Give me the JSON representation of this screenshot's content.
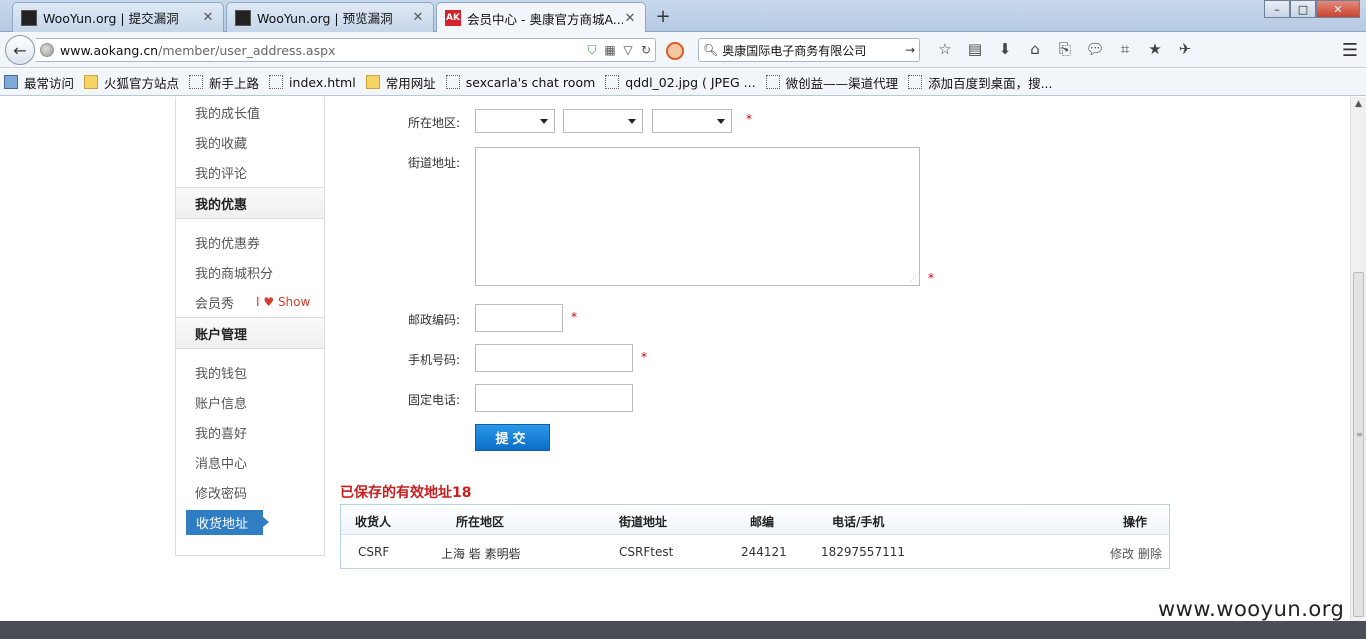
{
  "browser": {
    "tabs": [
      {
        "title": "WooYun.org | 提交漏洞",
        "icon": "wooyun-favicon",
        "active": false
      },
      {
        "title": "WooYun.org | 预览漏洞",
        "icon": "wooyun-favicon",
        "active": false
      },
      {
        "title": "会员中心 - 奥康官方商城A...",
        "icon": "aokang-favicon",
        "active": true
      }
    ],
    "ak_favicon_text": "AK",
    "new_tab": "+",
    "url_host": "www.aokang.cn",
    "url_path": "/member/user_address.aspx",
    "search_text": "奥康国际电子商务有限公司",
    "bookmarks": [
      {
        "label": "最常访问",
        "kind": "first"
      },
      {
        "label": "火狐官方站点",
        "kind": "folder"
      },
      {
        "label": "新手上路",
        "kind": "page"
      },
      {
        "label": "index.html",
        "kind": "page"
      },
      {
        "label": "常用网址",
        "kind": "folder"
      },
      {
        "label": "sexcarla's chat room",
        "kind": "page"
      },
      {
        "label": "qddl_02.jpg ( JPEG ...",
        "kind": "page"
      },
      {
        "label": "微创益——渠道代理",
        "kind": "page"
      },
      {
        "label": "添加百度到桌面，搜...",
        "kind": "page"
      }
    ]
  },
  "sidebar": {
    "top_items": [
      "我的成长值",
      "我的收藏",
      "我的评论"
    ],
    "groups": [
      {
        "title": "我的优惠",
        "items": [
          "我的优惠券",
          "我的商城积分",
          "会员秀"
        ]
      },
      {
        "title": "账户管理",
        "items": [
          "我的钱包",
          "账户信息",
          "我的喜好",
          "消息中心",
          "修改密码",
          "收货地址"
        ]
      }
    ],
    "show_badge": "I ♥ Show",
    "active_item": "收货地址"
  },
  "form": {
    "region_label": "所在地区:",
    "street_label": "街道地址:",
    "postcode_label": "邮政编码:",
    "mobile_label": "手机号码:",
    "phone_label": "固定电话:",
    "required_mark": "*",
    "submit_label": "提交"
  },
  "saved": {
    "title": "已保存的有效地址18",
    "columns": [
      "收货人",
      "所在地区",
      "街道地址",
      "邮编",
      "电话/手机",
      "操作"
    ],
    "rows": [
      {
        "name": "CSRF",
        "region": "上海 砦 素明砦",
        "street": "CSRFtest",
        "postcode": "244121",
        "phone": "18297557111",
        "edit": "修改",
        "delete": "删除"
      }
    ]
  },
  "watermark": "www.wooyun.org"
}
